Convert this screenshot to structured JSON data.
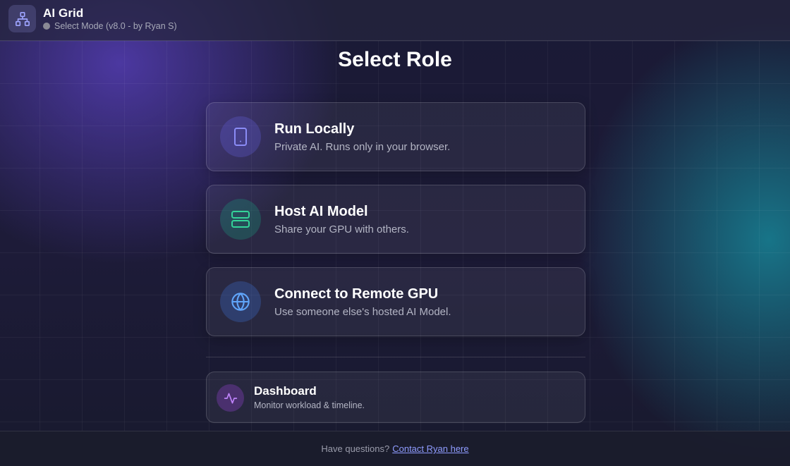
{
  "header": {
    "app_title": "AI Grid",
    "status_text": "Select Mode (v8.0 - by Ryan S)",
    "status_color": "#8a8a95"
  },
  "main": {
    "title": "Select Role",
    "options": [
      {
        "title": "Run Locally",
        "description": "Private AI. Runs only in your browser.",
        "icon": "tablet-icon",
        "accent": "#8b8cf6"
      },
      {
        "title": "Host AI Model",
        "description": "Share your GPU with others.",
        "icon": "server-icon",
        "accent": "#34d399"
      },
      {
        "title": "Connect to Remote GPU",
        "description": "Use someone else's hosted AI Model.",
        "icon": "globe-icon",
        "accent": "#60a5fa"
      }
    ],
    "dashboard": {
      "title": "Dashboard",
      "description": "Monitor workload & timeline.",
      "icon": "activity-icon",
      "accent": "#c084fc"
    }
  },
  "footer": {
    "text": "Have questions?",
    "link_label": "Contact Ryan here"
  }
}
